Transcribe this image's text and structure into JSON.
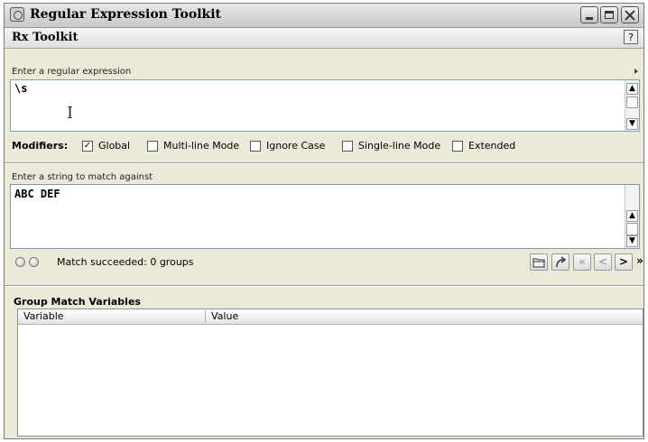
{
  "window": {
    "title": "Regular Expression Toolkit",
    "panel_title": "Rx Toolkit",
    "help_label": "?"
  },
  "regex": {
    "label": "Enter a regular expression",
    "value": "\\s"
  },
  "modifiers": {
    "label": "Modifiers:",
    "options": [
      {
        "label": "Global",
        "checked": true
      },
      {
        "label": "Multi-line Mode",
        "checked": false
      },
      {
        "label": "Ignore Case",
        "checked": false
      },
      {
        "label": "Single-line Mode",
        "checked": false
      },
      {
        "label": "Extended",
        "checked": false
      }
    ]
  },
  "subject": {
    "label": "Enter a string to match against",
    "value": "ABC DEF"
  },
  "status": {
    "text": "Match succeeded: 0 groups"
  },
  "toolbar": {
    "open_icon": "folder-icon",
    "replace_icon": "replace-arrow-icon",
    "first_label": "«",
    "prev_label": "<",
    "next_label": ">",
    "last_label": "»"
  },
  "group_match": {
    "title": "Group Match Variables",
    "columns": [
      "Variable",
      "Value"
    ],
    "rows": []
  }
}
